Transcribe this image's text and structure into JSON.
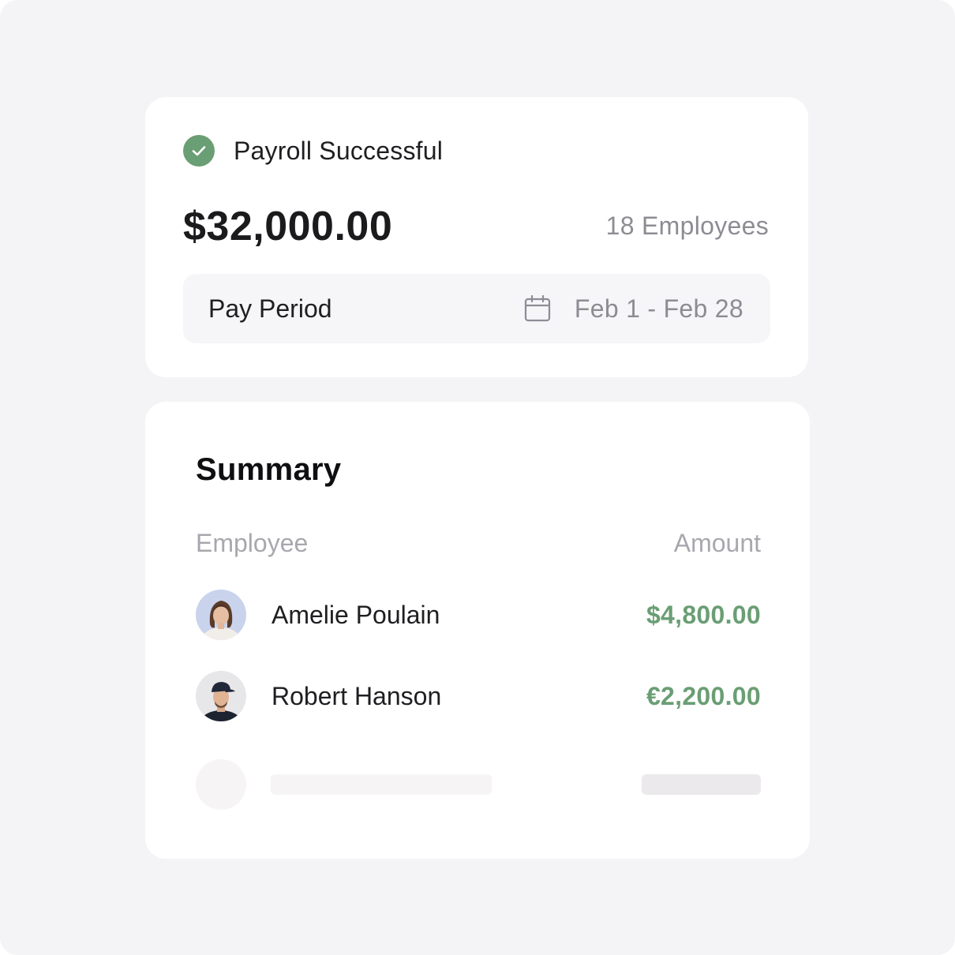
{
  "payroll": {
    "status": "Payroll Successful",
    "total": "$32,000.00",
    "employee_count": "18 Employees",
    "pay_period_label": "Pay Period",
    "pay_period_dates": "Feb 1 - Feb 28"
  },
  "summary": {
    "title": "Summary",
    "columns": {
      "employee": "Employee",
      "amount": "Amount"
    },
    "rows": [
      {
        "name": "Amelie Poulain",
        "amount": "$4,800.00"
      },
      {
        "name": "Robert Hanson",
        "amount": "€2,200.00"
      }
    ]
  },
  "colors": {
    "background": "#f4f3f5",
    "card": "#ffffff",
    "success": "#6a9e74",
    "muted_text": "#8e8c93"
  },
  "icons": [
    "check-circle-icon",
    "calendar-icon"
  ]
}
